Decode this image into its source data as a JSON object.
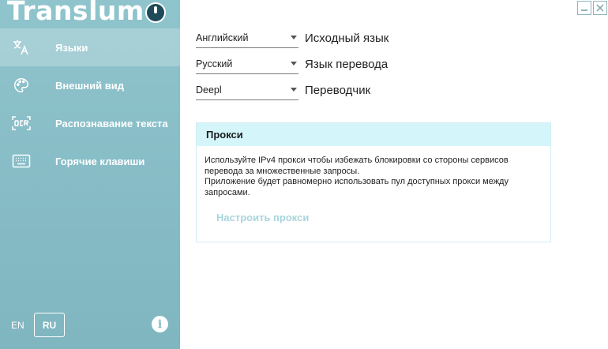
{
  "app": {
    "title": "Translum"
  },
  "sidebar": {
    "items": [
      {
        "label": "Языки",
        "icon": "translate-icon"
      },
      {
        "label": "Внешний вид",
        "icon": "palette-icon"
      },
      {
        "label": "Распознавание текста",
        "icon": "ocr-icon"
      },
      {
        "label": "Горячие клавиши",
        "icon": "keyboard-icon"
      }
    ],
    "active_index": 0,
    "lang_en": "EN",
    "lang_ru": "RU",
    "info_glyph": "i"
  },
  "settings": {
    "source": {
      "value": "Английский",
      "label": "Исходный язык"
    },
    "target": {
      "value": "Русский",
      "label": "Язык перевода"
    },
    "translator": {
      "value": "Deepl",
      "label": "Переводчик"
    }
  },
  "proxy": {
    "title": "Прокси",
    "desc_line1": "Используйте IPv4 прокси чтобы избежать блокировки со стороны сервисов перевода за множественные запросы.",
    "desc_line2": "Приложение будет равномерно использовать пул доступных прокси между запросами.",
    "button": "Настроить прокси"
  },
  "colors": {
    "sidebar": "#8fc4cc",
    "proxy_header": "#d4f6fb",
    "proxy_button": "#a9d5dc"
  }
}
